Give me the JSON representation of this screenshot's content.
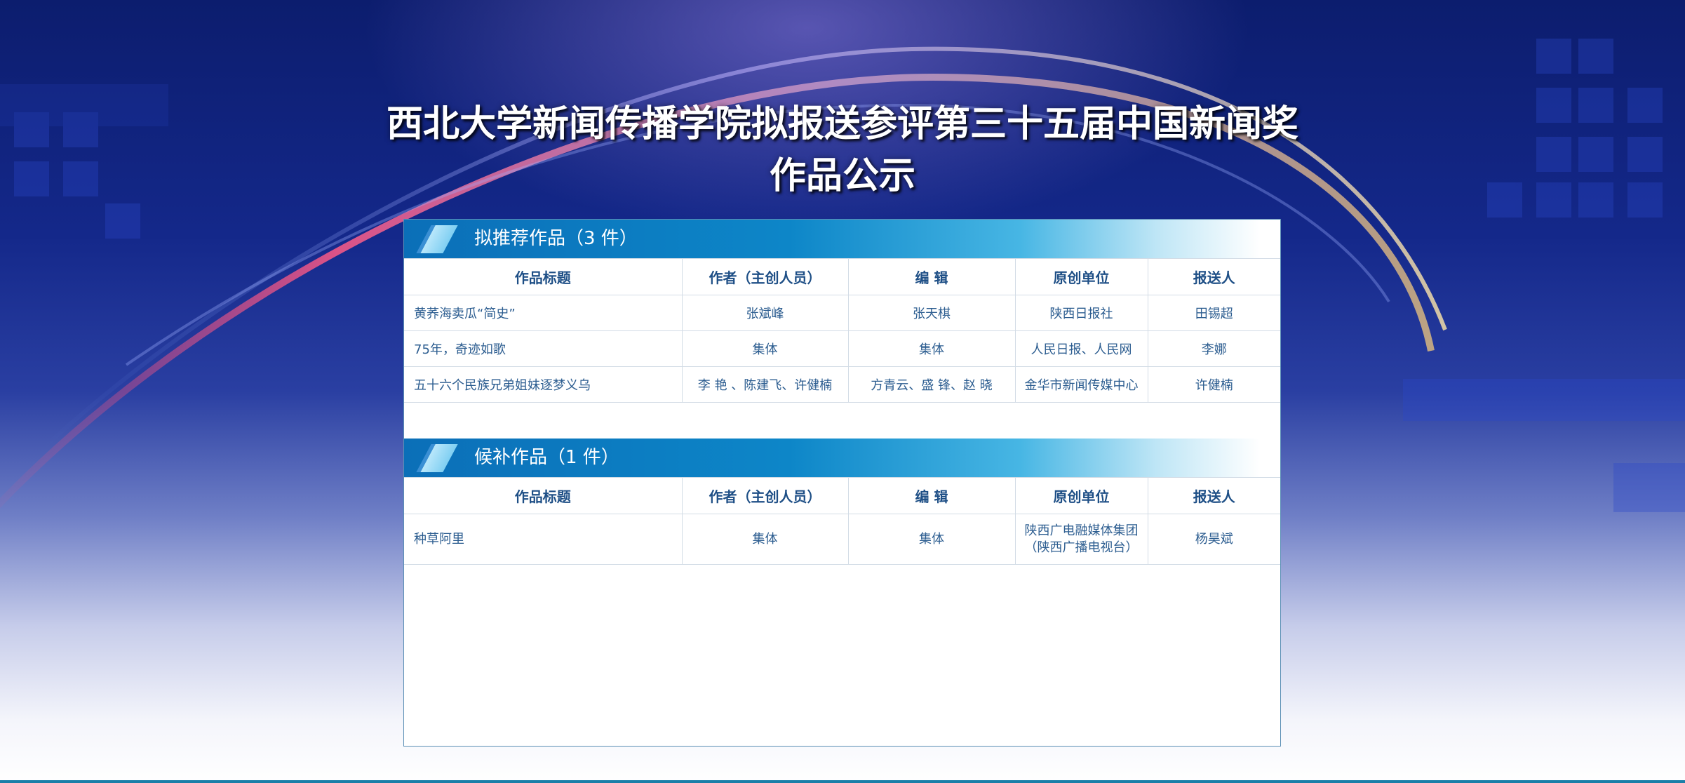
{
  "title": {
    "line1": "西北大学新闻传播学院拟报送参评第三十五届中国新闻奖",
    "line2": "作品公示"
  },
  "colors": {
    "accent": "#0d86c8",
    "table_text": "#2c5d90",
    "border": "#5b8fb5"
  },
  "sections": [
    {
      "label": "拟推荐作品（3 件）",
      "headers": [
        "作品标题",
        "作者（主创人员）",
        "编 辑",
        "原创单位",
        "报送人"
      ],
      "rows": [
        [
          "黄荞海卖瓜“简史”",
          "张斌峰",
          "张天棋",
          "陕西日报社",
          "田锡超"
        ],
        [
          "75年，奇迹如歌",
          "集体",
          "集体",
          "人民日报、人民网",
          "李娜"
        ],
        [
          "五十六个民族兄弟姐妹逐梦义乌",
          "李 艳 、陈建飞、许健楠",
          "方青云、盛 锋、赵 晓",
          "金华市新闻传媒中心",
          "许健楠"
        ]
      ]
    },
    {
      "label": "候补作品（1 件）",
      "headers": [
        "作品标题",
        "作者（主创人员）",
        "编 辑",
        "原创单位",
        "报送人"
      ],
      "rows": [
        [
          "种草阿里",
          "集体",
          "集体",
          "陕西广电融媒体集团",
          "杨昊斌"
        ]
      ],
      "row_extra": "（陕西广播电视台）"
    }
  ]
}
